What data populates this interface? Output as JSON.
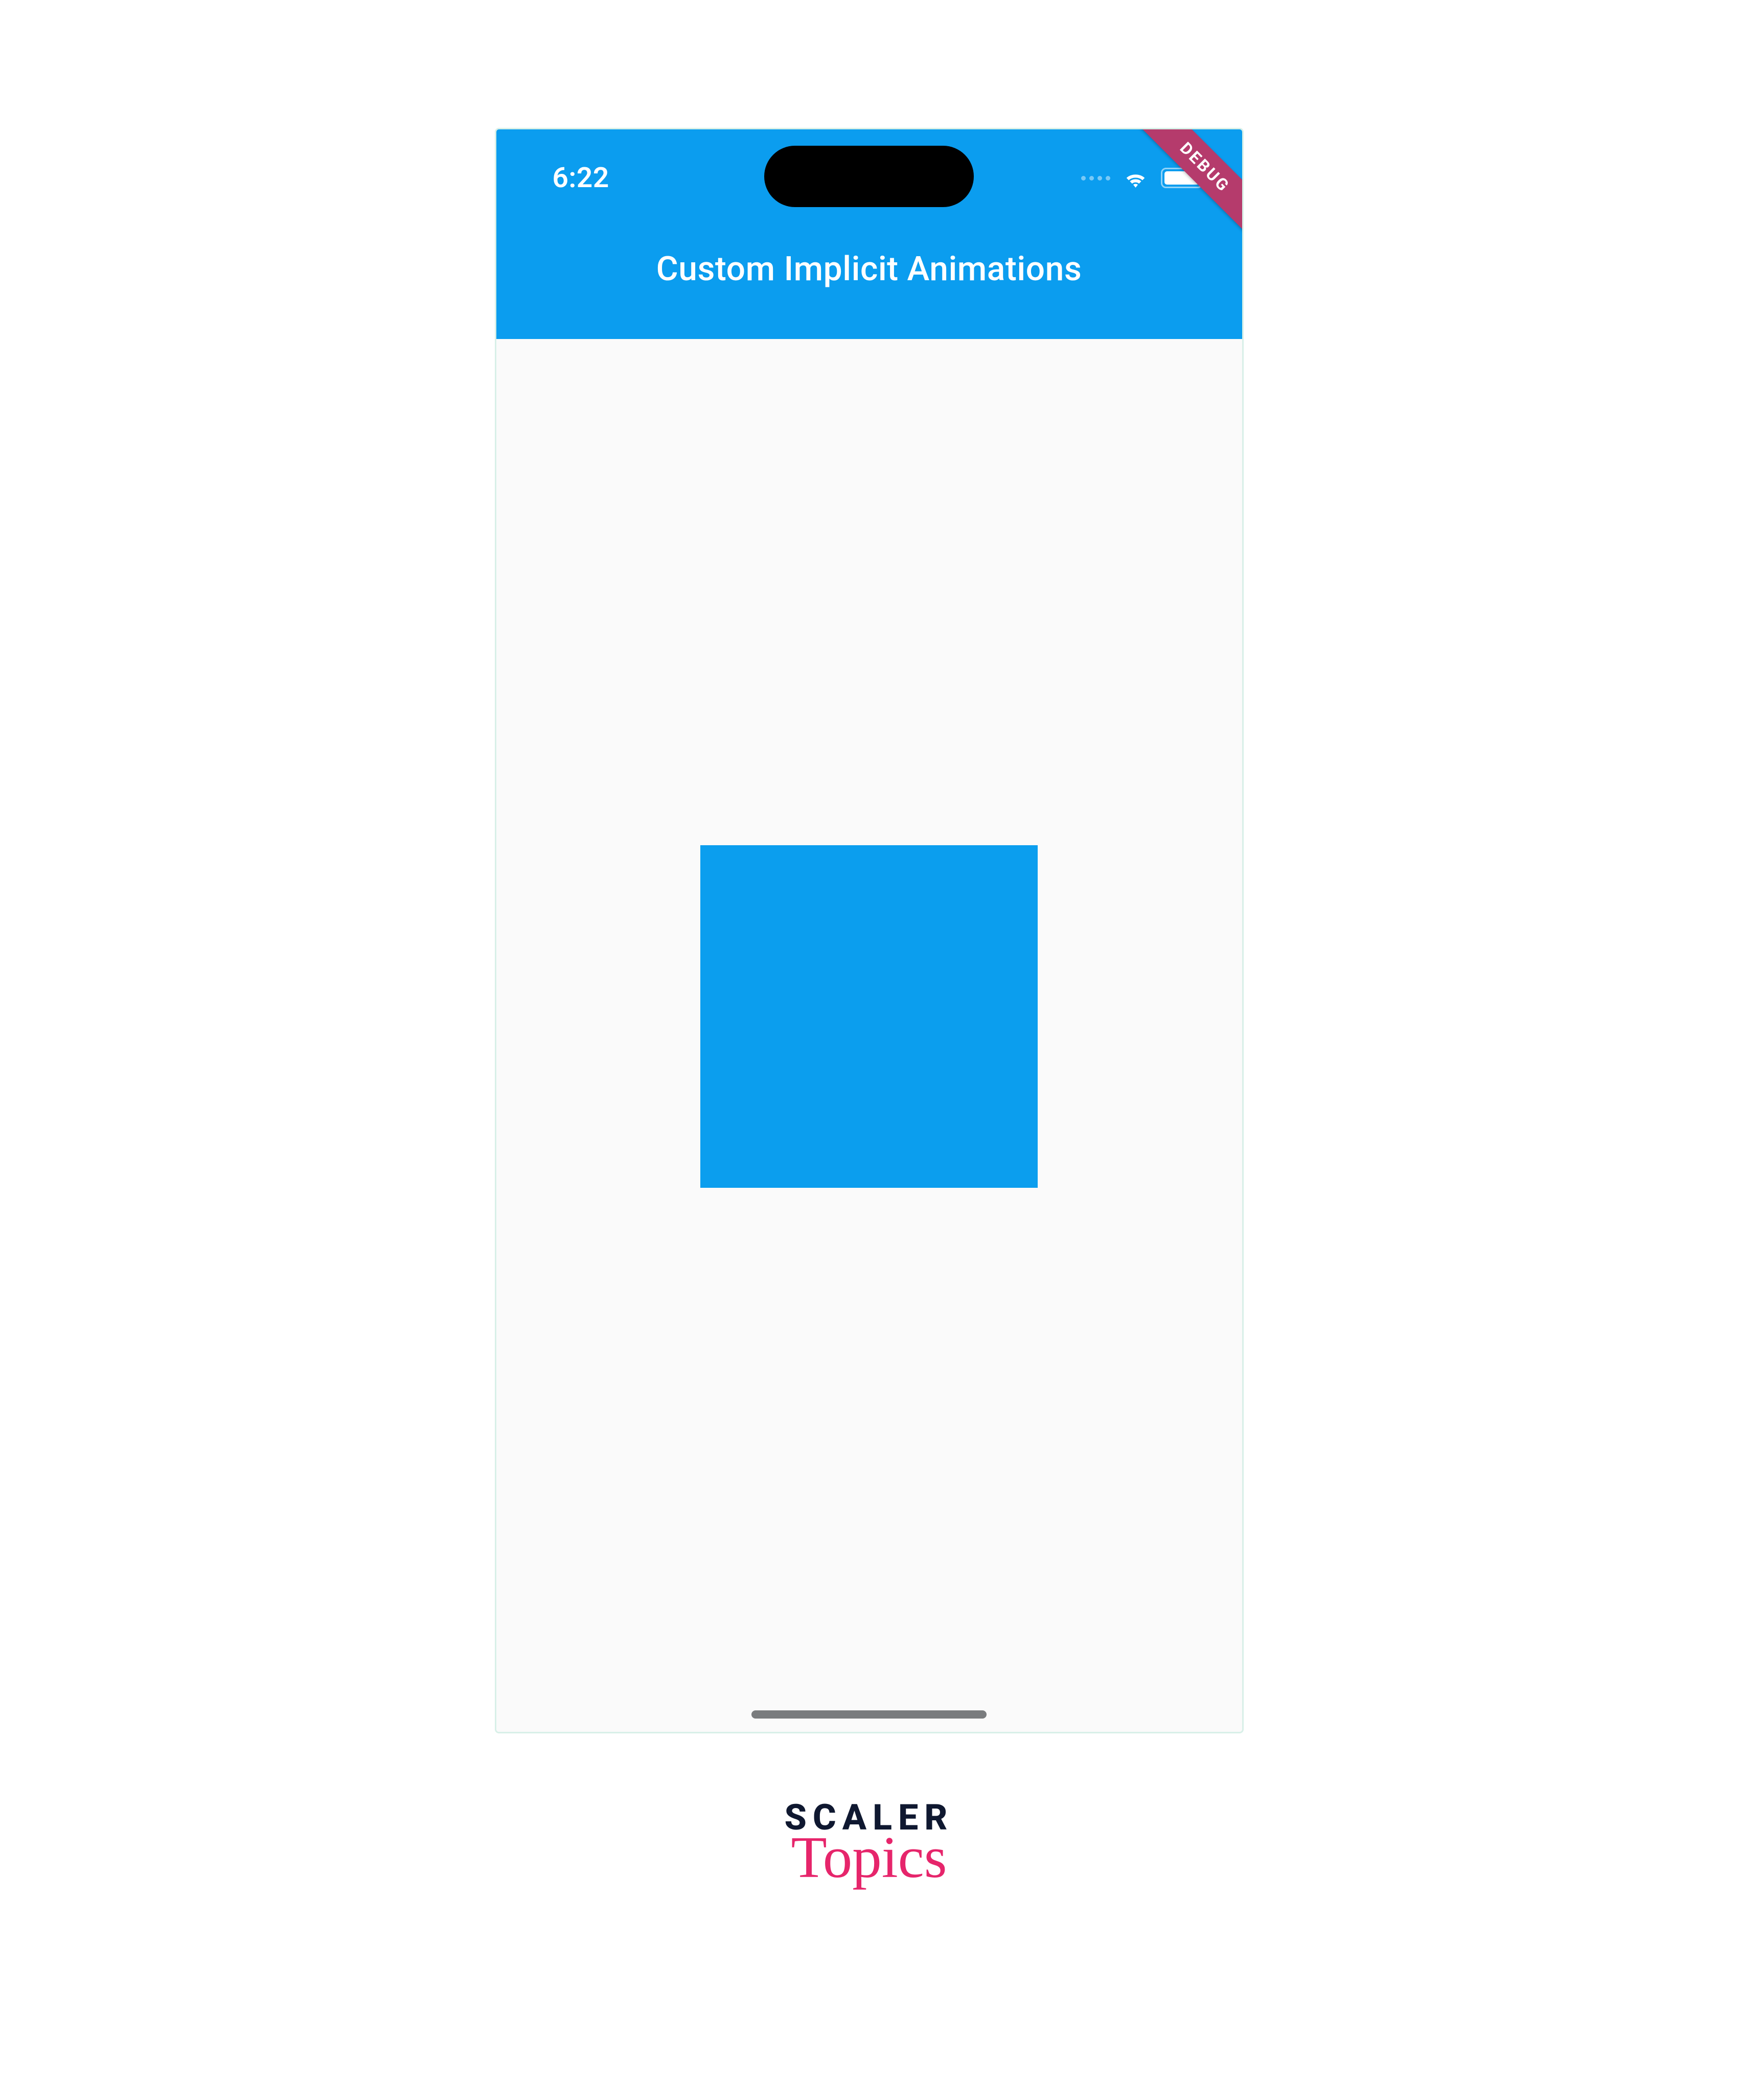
{
  "status_bar": {
    "time": "6:22"
  },
  "app_bar": {
    "title": "Custom Implicit Animations"
  },
  "debug_banner": {
    "label": "DEBUG"
  },
  "body": {
    "box_color": "#0b9eee"
  },
  "brand": {
    "line1": "SCALER",
    "line2": "Topics"
  }
}
